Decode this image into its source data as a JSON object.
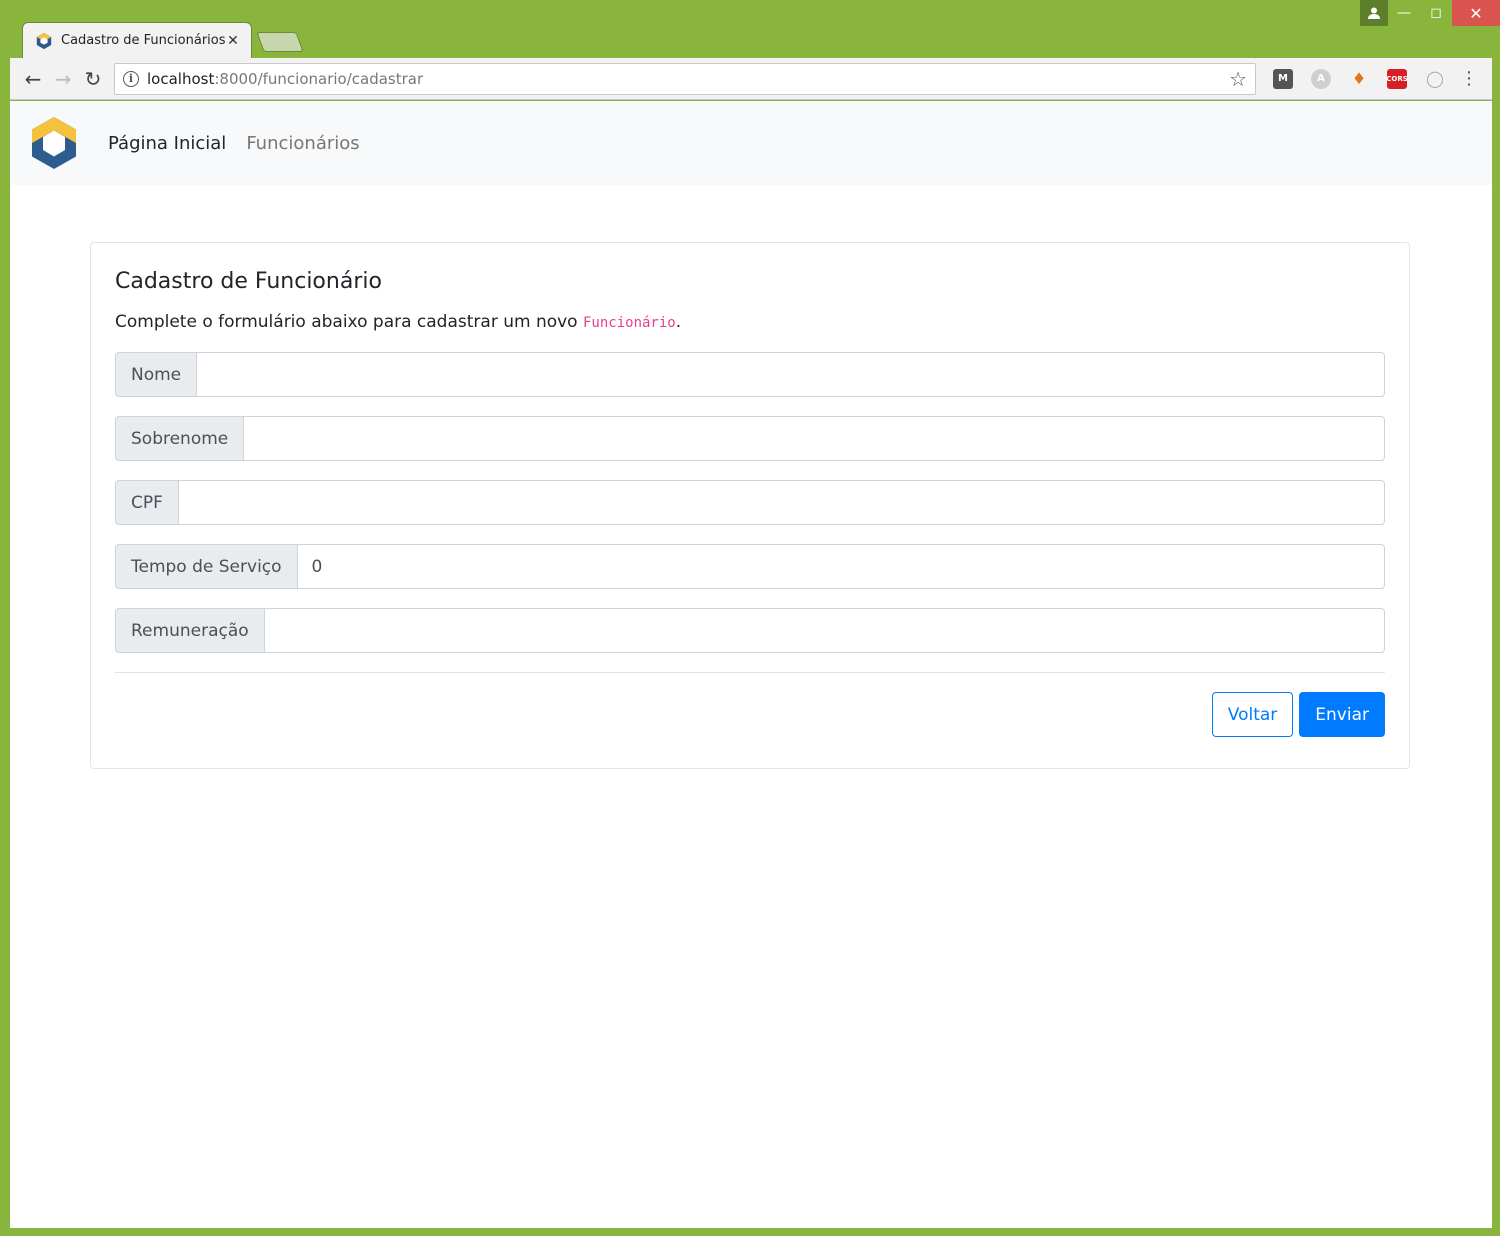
{
  "browser": {
    "tab_title": "Cadastro de Funcionários",
    "tab_close": "✕",
    "url_host": "localhost",
    "url_rest": ":8000/funcionario/cadastrar",
    "icons": [
      "back-icon",
      "forward-icon",
      "reload-icon",
      "info-icon",
      "star-icon",
      "menu-icon"
    ],
    "ext_cors": "CORS"
  },
  "navbar": {
    "links": [
      {
        "label": "Página Inicial"
      },
      {
        "label": "Funcionários"
      }
    ]
  },
  "form": {
    "title": "Cadastro de Funcionário",
    "description_prefix": "Complete o formulário abaixo para cadastrar um novo ",
    "description_code": "Funcionário",
    "description_suffix": ".",
    "fields": [
      {
        "label": "Nome",
        "value": ""
      },
      {
        "label": "Sobrenome",
        "value": ""
      },
      {
        "label": "CPF",
        "value": ""
      },
      {
        "label": "Tempo de Serviço",
        "value": "0"
      },
      {
        "label": "Remuneração",
        "value": ""
      }
    ],
    "buttons": {
      "back": "Voltar",
      "submit": "Enviar"
    }
  },
  "colors": {
    "window_frame": "#8ab53c",
    "primary": "#007bff",
    "code": "#e83e8c"
  }
}
